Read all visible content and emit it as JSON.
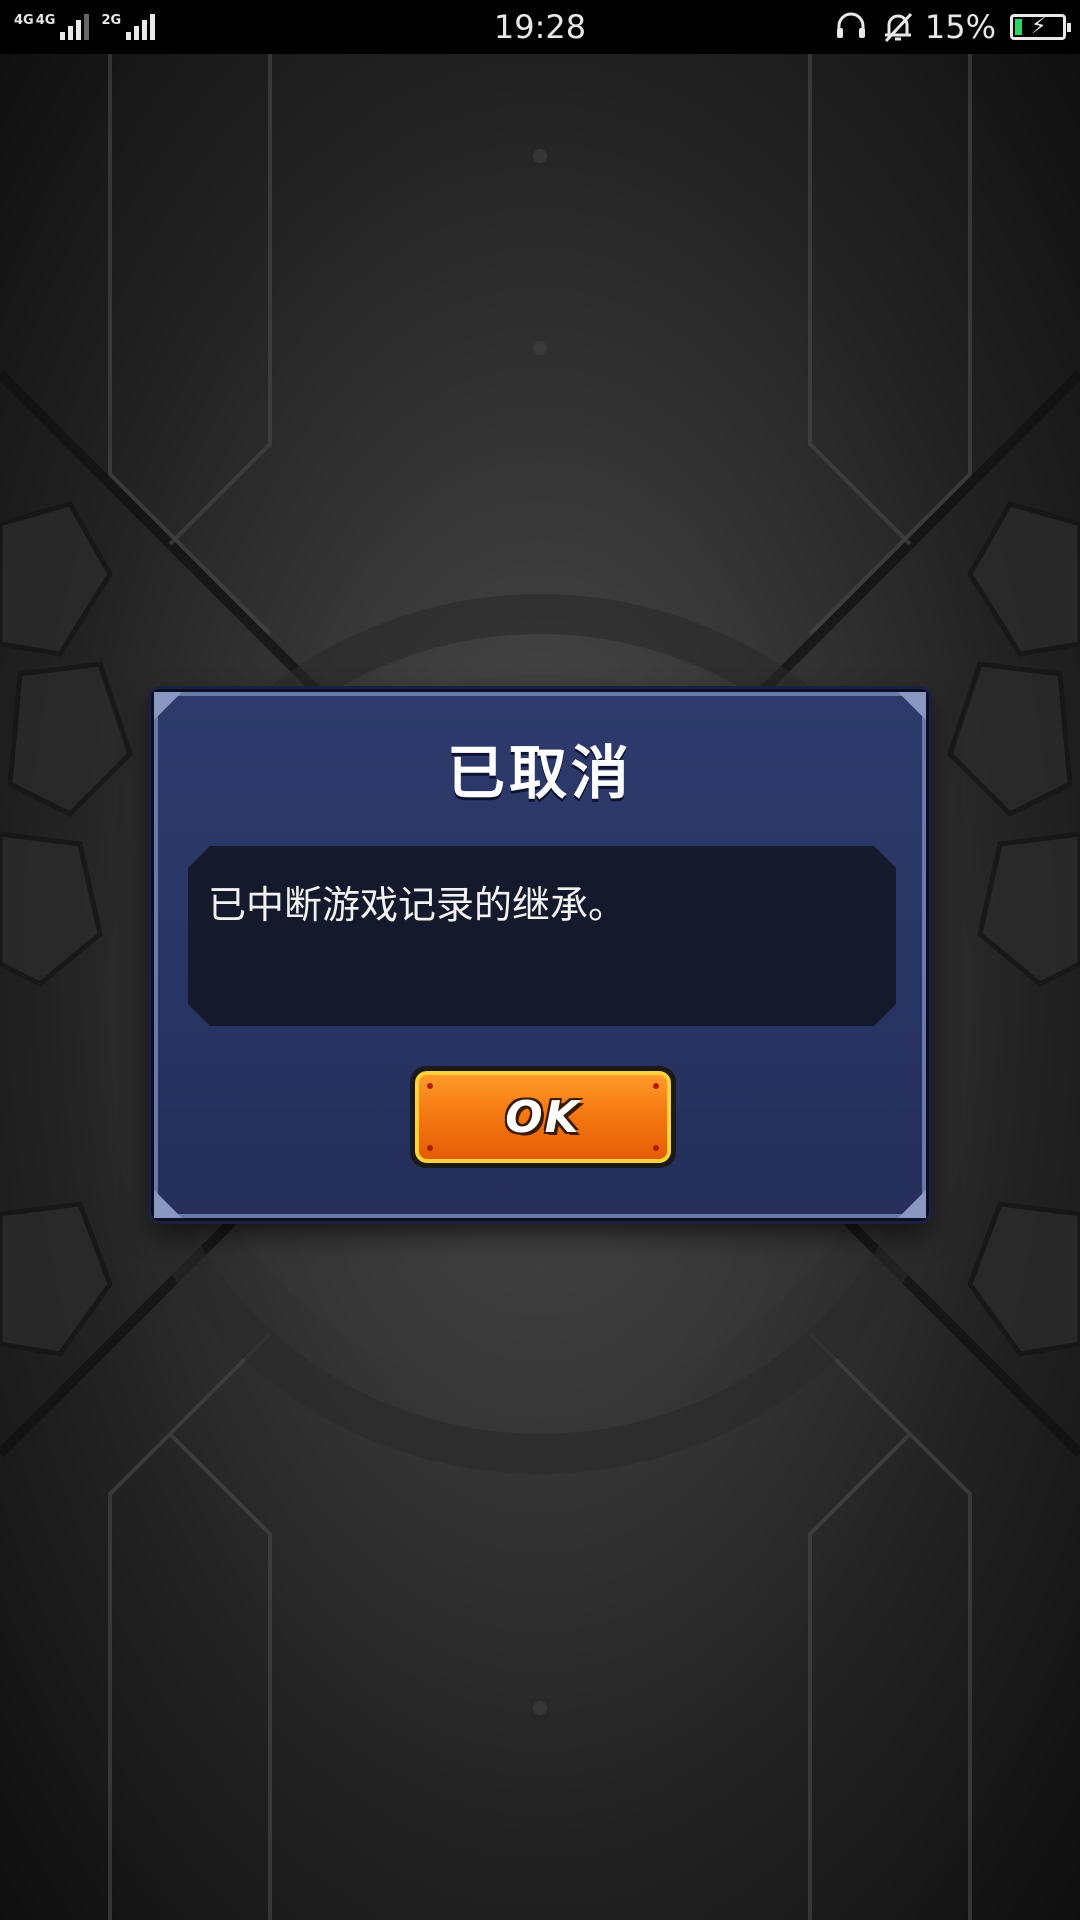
{
  "status_bar": {
    "network_1": "4G",
    "network_2": "4G",
    "network_3": "2G",
    "time": "19:28",
    "battery_percent": "15%",
    "battery_level": 0.15,
    "battery_color": "#2fd36a"
  },
  "dialog": {
    "title": "已取消",
    "message": "已中断游戏记录的继承。",
    "ok_label": "OK",
    "panel_color": "#2d3a6b",
    "button_color": "#f57a12"
  }
}
